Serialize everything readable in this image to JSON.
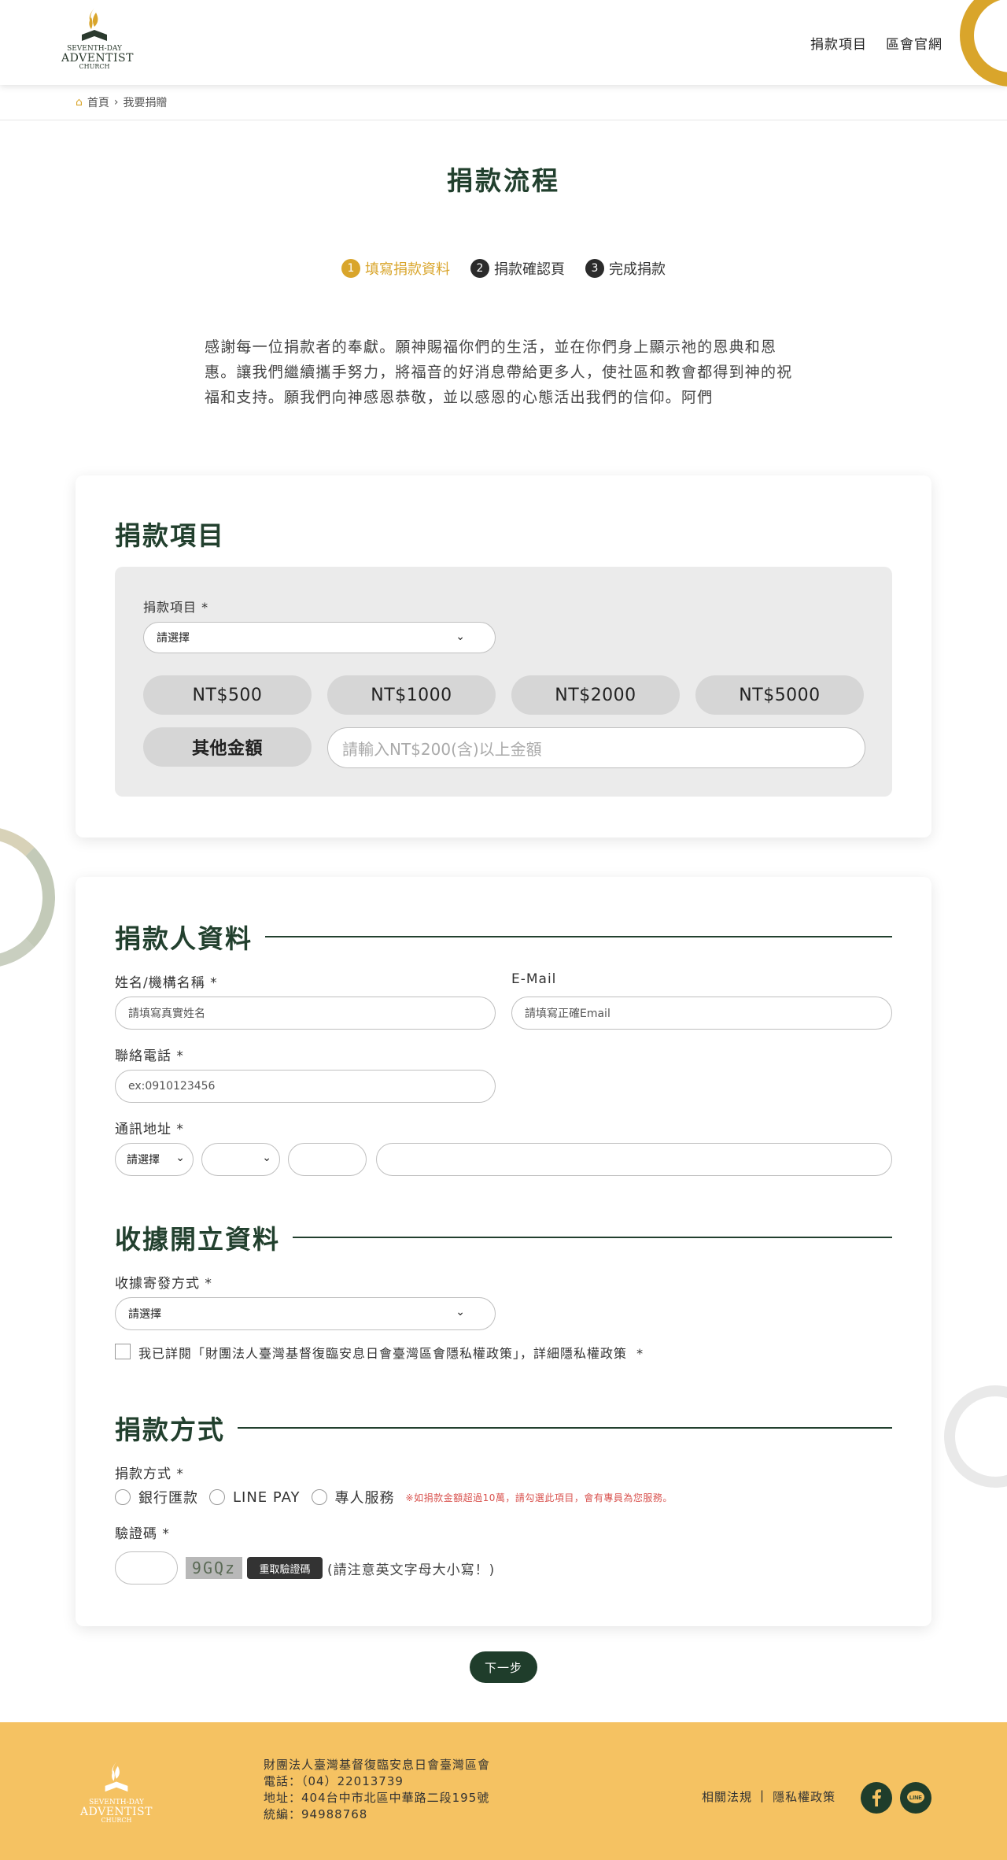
{
  "header": {
    "logo": {
      "line1": "SEVENTH-DAY",
      "line2": "ADVENTIST",
      "line3": "CHURCH"
    },
    "nav": [
      "捐款項目",
      "區會官網"
    ]
  },
  "breadcrumb": {
    "home": "首頁",
    "current": "我要捐贈"
  },
  "page_title": "捐款流程",
  "steps": [
    {
      "num": "1",
      "label": "填寫捐款資料"
    },
    {
      "num": "2",
      "label": "捐款確認頁"
    },
    {
      "num": "3",
      "label": "完成捐款"
    }
  ],
  "intro": "感謝每一位捐款者的奉獻。願神賜福你們的生活，並在你們身上顯示祂的恩典和恩惠。讓我們繼續攜手努力，將福音的好消息帶給更多人，使社區和教會都得到神的祝福和支持。願我們向神感恩恭敬，並以感恩的心態活出我們的信仰。阿們",
  "donation": {
    "title": "捐款項目",
    "item_label": "捐款項目 *",
    "item_select": "請選擇",
    "amounts": [
      "NT$500",
      "NT$1000",
      "NT$2000",
      "NT$5000"
    ],
    "other_label": "其他金額",
    "other_placeholder": "請輸入NT$200(含)以上金額"
  },
  "donor": {
    "title": "捐款人資料",
    "name_label": "姓名/機構名稱 *",
    "name_placeholder": "請填寫真實姓名",
    "email_label": "E-Mail",
    "email_placeholder": "請填寫正確Email",
    "phone_label": "聯絡電話 *",
    "phone_placeholder": "ex:0910123456",
    "address_label": "通訊地址 *",
    "city_select": "請選擇",
    "district_select": "",
    "zip_value": "",
    "street_value": ""
  },
  "receipt": {
    "title": "收據開立資料",
    "method_label": "收據寄發方式 *",
    "method_select": "請選擇",
    "privacy_text": "我已詳閱「財團法人臺灣基督復臨安息日會臺灣區會隱私權政策」，詳細隱私權政策",
    "privacy_required": "*"
  },
  "payment": {
    "title": "捐款方式",
    "method_label": "捐款方式 *",
    "options": [
      "銀行匯款",
      "LINE PAY",
      "專人服務"
    ],
    "note": "※如捐款金額超過10萬，請勾選此項目，會有專員為您服務。",
    "captcha_label": "驗證碼 *",
    "captcha_value": "",
    "captcha_code": "9GQz",
    "captcha_refresh": "重取驗證碼",
    "captcha_hint": "(請注意英文字母大小寫！)"
  },
  "next_button": "下一步",
  "footer": {
    "org": "財團法人臺灣基督復臨安息日會臺灣區會",
    "phone": "電話：（04）22013739",
    "address": "地址：404台中市北區中華路二段195號",
    "tax_id": "統編：94988768",
    "link_law": "相關法規",
    "separator": "|",
    "link_privacy": "隱私權政策",
    "social": [
      "facebook-icon",
      "line-icon"
    ]
  },
  "colors": {
    "accent": "#d9a52b",
    "primary": "#1f3d2b",
    "footer_bg": "#f5c262"
  }
}
